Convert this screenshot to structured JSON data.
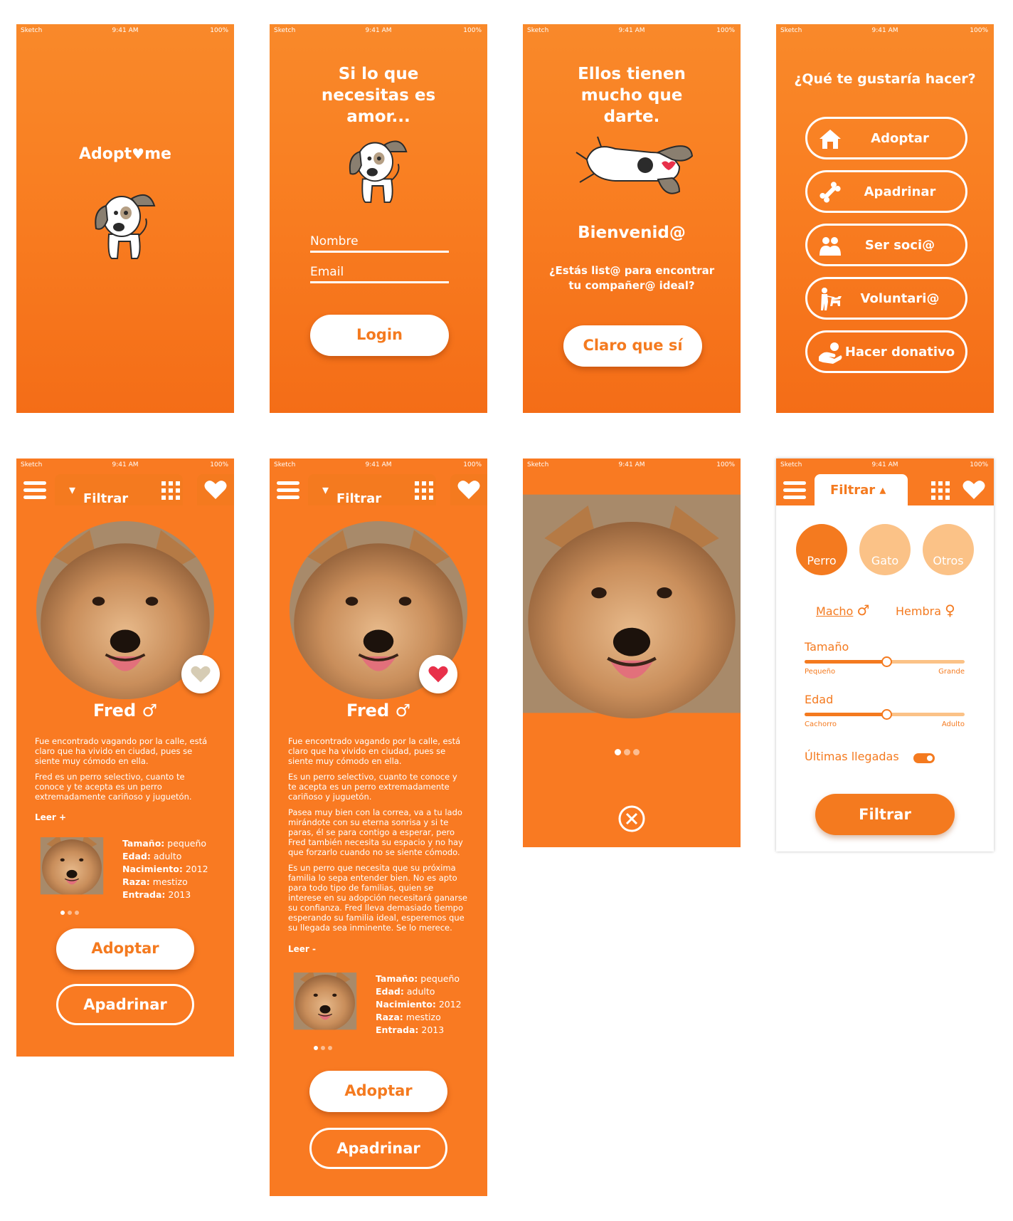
{
  "status": {
    "carrier": "Sketch",
    "time": "9:41 AM",
    "battery": "100%"
  },
  "splash": {
    "logo_part1": "Adopt",
    "logo_part2": "me"
  },
  "login": {
    "title": "Si lo que necesitas es amor...",
    "name_placeholder": "Nombre",
    "email_placeholder": "Email",
    "login_label": "Login"
  },
  "welcome": {
    "title": "Ellos tienen mucho que darte.",
    "heading": "Bienvenid@",
    "question": "¿Estás list@ para encontrar tu compañer@ ideal?",
    "cta_label": "Claro que sí"
  },
  "menu": {
    "title": "¿Qué te gustaría hacer?",
    "items": [
      {
        "label": "Adoptar",
        "icon": "house-icon"
      },
      {
        "label": "Apadrinar",
        "icon": "bone-icon"
      },
      {
        "label": "Ser soci@",
        "icon": "people-icon"
      },
      {
        "label": "Voluntari@",
        "icon": "dog-walker-icon"
      },
      {
        "label": "Hacer donativo",
        "icon": "donate-hand-icon"
      }
    ]
  },
  "nav": {
    "filter_label": "Filtrar"
  },
  "pet": {
    "name": "Fred",
    "gender_symbol": "♂",
    "short_paragraphs": [
      "Fue encontrado vagando por la calle, está claro que ha vivido en ciudad, pues se siente muy cómodo en ella.",
      "Fred es un perro selectivo, cuanto te conoce y te acepta es un perro extremadamente cariñoso y juguetón."
    ],
    "long_paragraphs": [
      "Fue encontrado vagando por la calle, está claro que ha vivido en ciudad, pues se siente muy cómodo en ella.",
      "Es un perro selectivo, cuanto te conoce y te acepta es un perro extremadamente cariñoso y juguetón.",
      "Pasea muy bien con la correa, va a tu lado mirándote con su eterna sonrisa y si te paras, él se para contigo a esperar, pero Fred también necesita su espacio y no hay que forzarlo cuando no se siente cómodo.",
      "Es un perro que necesita que su próxima familia lo sepa entender bien. No es apto para todo tipo de familias, quien se interese en su adopción necesitará ganarse su confianza. Fred lleva demasiado tiempo esperando su familia ideal, esperemos que su llegada sea inminente. Se lo merece."
    ],
    "read_more": "Leer +",
    "read_less": "Leer -",
    "facts": [
      {
        "key": "Tamaño:",
        "value": "pequeño"
      },
      {
        "key": "Edad:",
        "value": "adulto"
      },
      {
        "key": "Nacimiento:",
        "value": "2012"
      },
      {
        "key": "Raza:",
        "value": "mestizo"
      },
      {
        "key": "Entrada:",
        "value": "2013"
      }
    ],
    "adopt_label": "Adoptar",
    "sponsor_label": "Apadrinar"
  },
  "filter": {
    "tab_label": "Filtrar",
    "categories": [
      "Perro",
      "Gato",
      "Otros"
    ],
    "male": "Macho",
    "female": "Hembra",
    "size_label": "Tamaño",
    "size_min": "Pequeño",
    "size_max": "Grande",
    "size_level": 0.5,
    "age_label": "Edad",
    "age_min": "Cachorro",
    "age_max": "Adulto",
    "age_level": 0.5,
    "latest_label": "Últimas llegadas",
    "latest_on": true,
    "apply_label": "Filtrar"
  },
  "colors": {
    "primary": "#f97a22",
    "dark_orange": "#f47a1f",
    "light_orange": "#fbc287",
    "heart_red": "#e8304a"
  }
}
